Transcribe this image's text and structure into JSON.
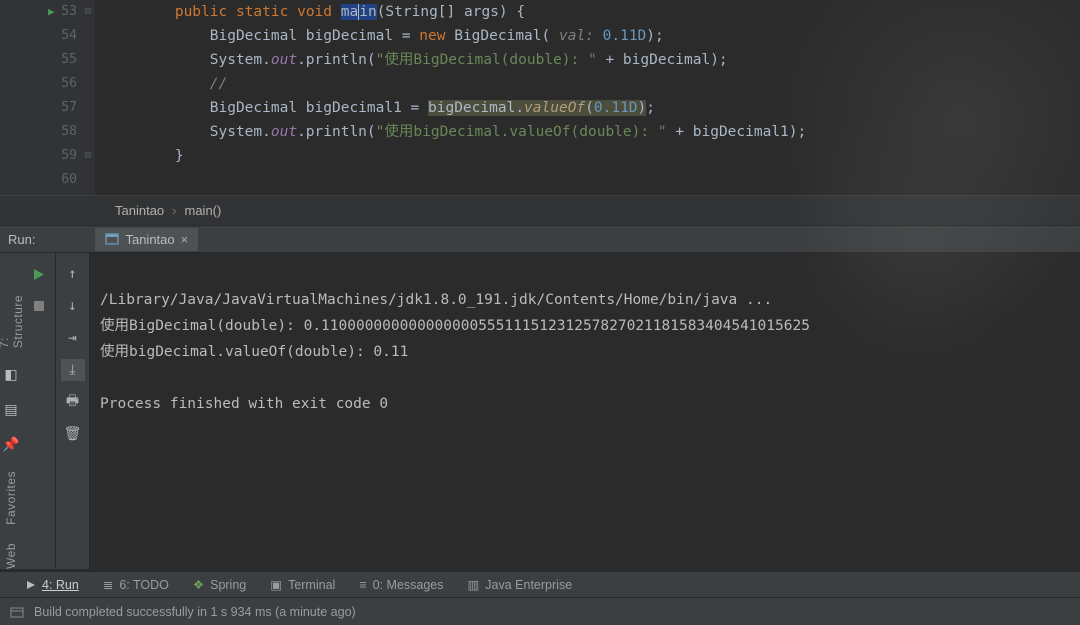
{
  "editor": {
    "lines": [
      "53",
      "54",
      "55",
      "56",
      "57",
      "58",
      "59",
      "60"
    ],
    "code": {
      "l53": {
        "prefix": "        ",
        "kw1": "public",
        "sp1": " ",
        "kw2": "static",
        "sp2": " ",
        "kw3": "void",
        "sp3": " ",
        "main_a": "ma",
        "main_b": "in",
        "paren": "(String[] args) {"
      },
      "l54": {
        "indent": "            ",
        "t1": "BigDecimal bigDecimal = ",
        "kw": "new",
        "t2": " BigDecimal(",
        "param": " val: ",
        "num": "0.11D",
        "t3": ");"
      },
      "l55": {
        "indent": "            ",
        "t1": "System.",
        "field": "out",
        "t2": ".println(",
        "str": "\"使用BigDecimal(double): \"",
        "t3": " + bigDecimal);"
      },
      "l56": {
        "indent": "            ",
        "comment": "//"
      },
      "l57": {
        "indent": "            ",
        "t1": "BigDecimal bigDecimal1 = ",
        "hl1": "bigDecimal.",
        "method": "valueOf",
        "hl2": "(",
        "num": "0.11D",
        "hl3": ")",
        ";": ";"
      },
      "l58": {
        "indent": "            ",
        "t1": "System.",
        "field": "out",
        "t2": ".println(",
        "str": "\"使用bigDecimal.valueOf(double): \"",
        "t3": " + bigDecimal1);"
      },
      "l59": {
        "indent": "        ",
        "brace": "}"
      }
    }
  },
  "breadcrumb": {
    "class": "Tanintao",
    "method": "main()",
    "sep": "›"
  },
  "run": {
    "label": "Run:",
    "tab": "Tanintao",
    "console_lines": [
      "/Library/Java/JavaVirtualMachines/jdk1.8.0_191.jdk/Contents/Home/bin/java ...",
      "使用BigDecimal(double): 0.11000000000000000055511151231257827021181583404541015625",
      "使用bigDecimal.valueOf(double): 0.11",
      "",
      "Process finished with exit code 0"
    ]
  },
  "left_tools": {
    "structure": "7: Structure",
    "favorites": "Favorites",
    "web": "Web"
  },
  "bottom_tabs": {
    "run": "4: Run",
    "todo": "6: TODO",
    "spring": "Spring",
    "terminal": "Terminal",
    "messages": "0: Messages",
    "java_ee": "Java Enterprise"
  },
  "status": {
    "msg": "Build completed successfully in 1 s 934 ms (a minute ago)"
  }
}
